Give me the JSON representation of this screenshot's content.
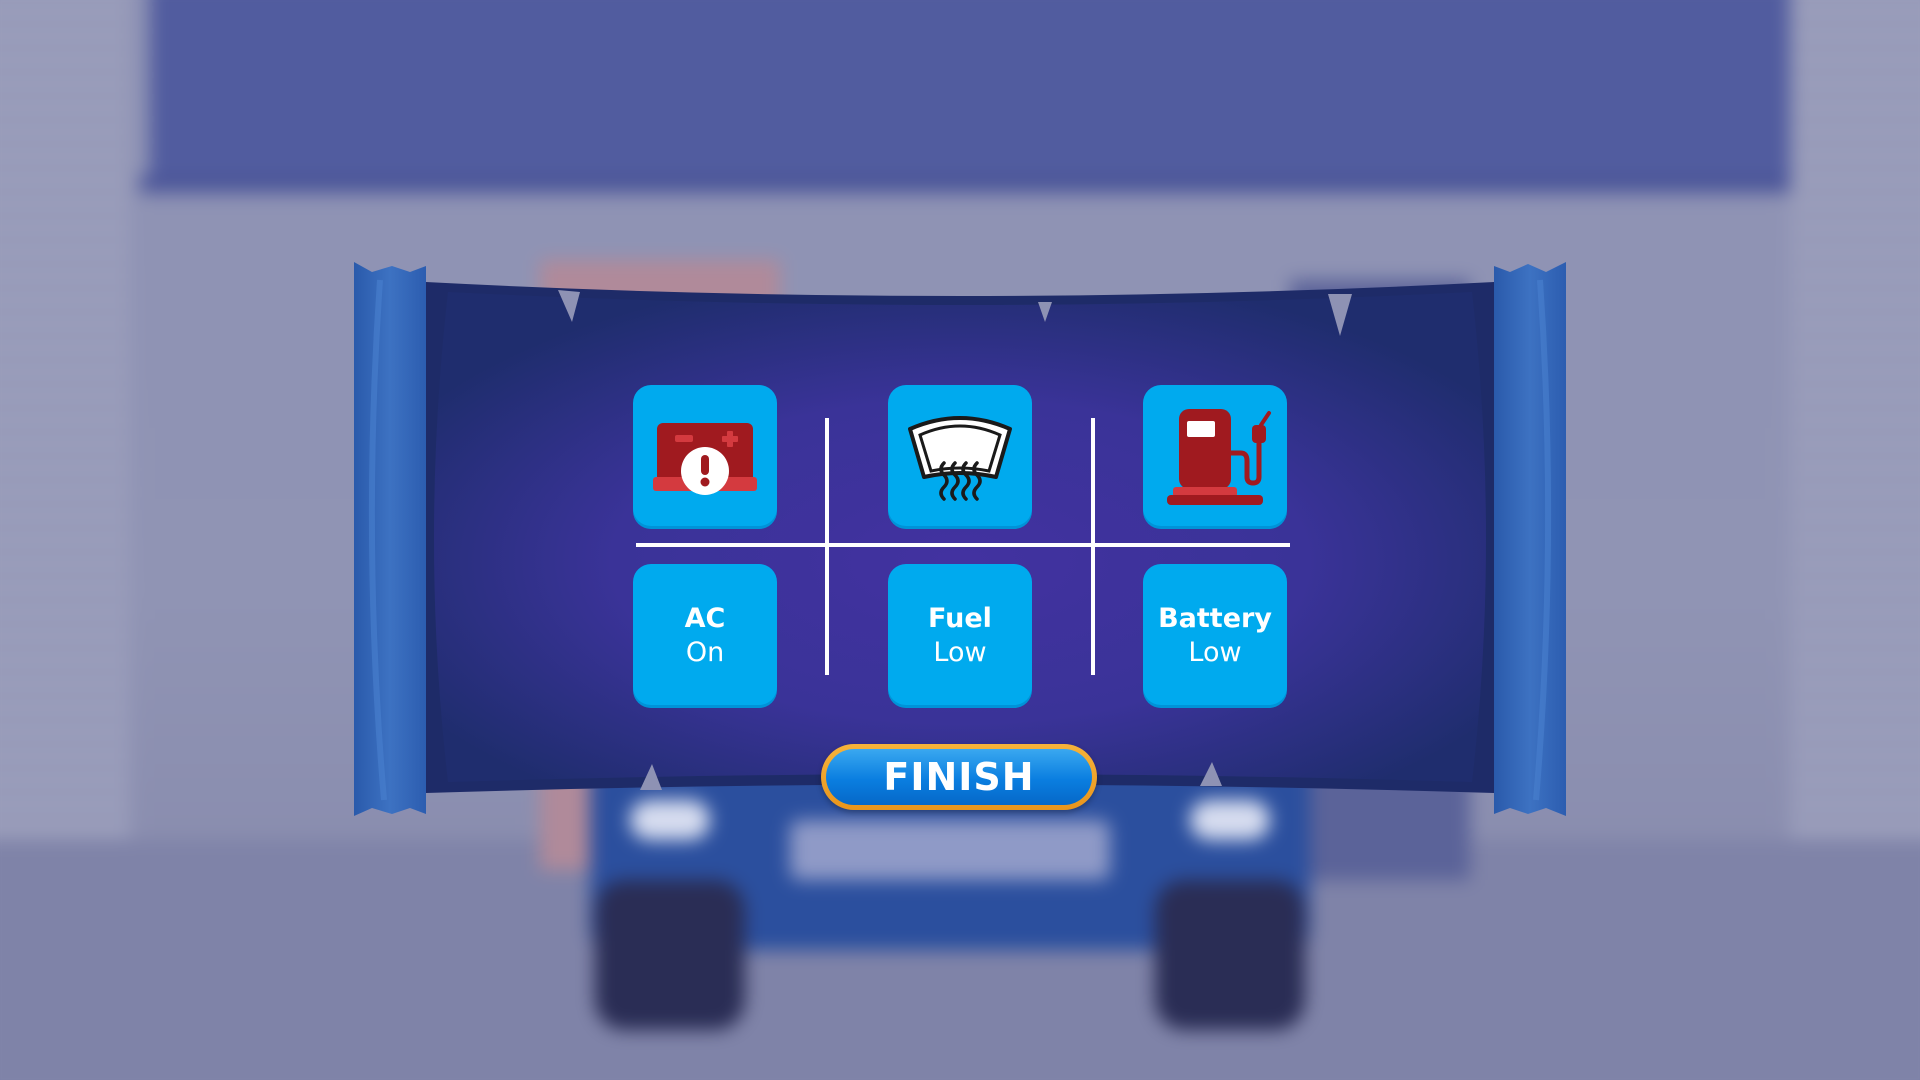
{
  "colors": {
    "tile": "#00aaee",
    "tile_text": "#ffffff",
    "banner_dark": "#1f2d6e",
    "banner_glow": "#4a3aa8",
    "banner_side": "#2e5fb0",
    "icon_red": "#a01a1f",
    "button_blue": "#0a7ee0",
    "button_border": "#f0a42a"
  },
  "icons": [
    {
      "name": "battery-warning-icon"
    },
    {
      "name": "windshield-defrost-icon"
    },
    {
      "name": "fuel-pump-icon"
    }
  ],
  "labels": [
    {
      "title": "AC",
      "state": "On"
    },
    {
      "title": "Fuel",
      "state": "Low"
    },
    {
      "title": "Battery",
      "state": "Low"
    }
  ],
  "finish": {
    "label": "FINISH"
  }
}
